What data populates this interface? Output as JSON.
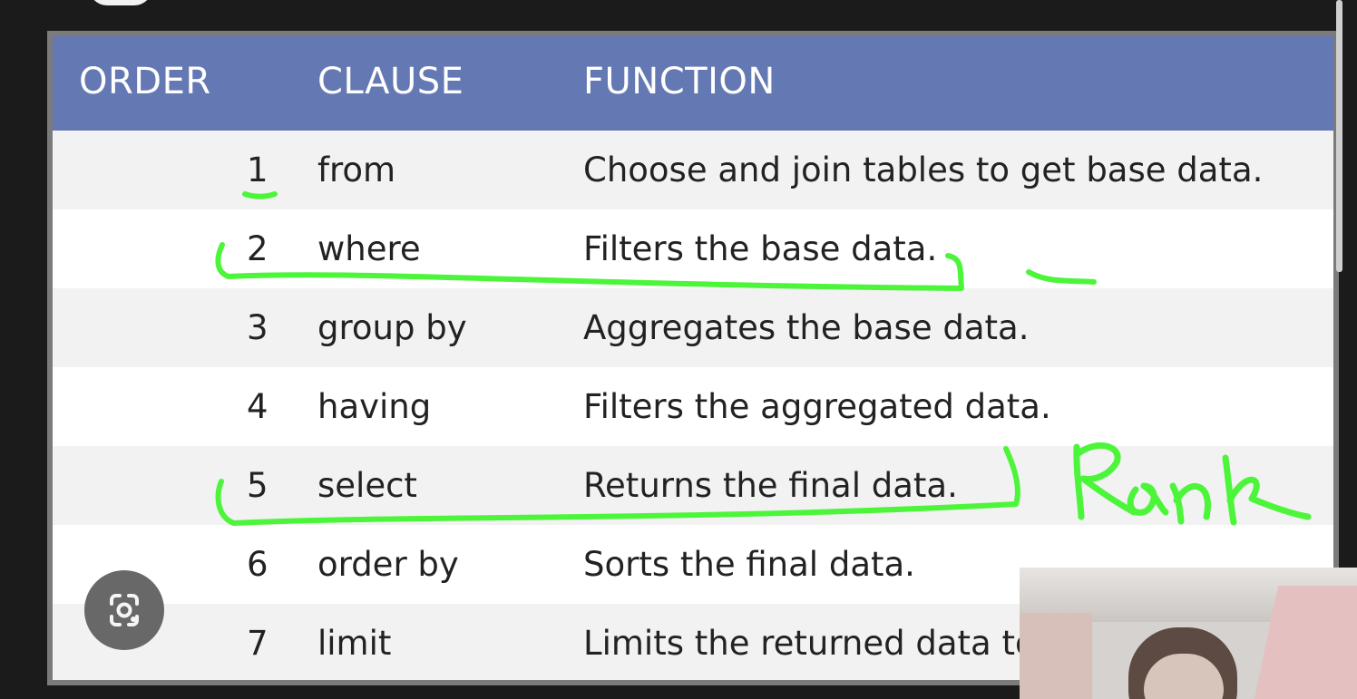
{
  "table": {
    "headers": [
      "ORDER",
      "CLAUSE",
      "FUNCTION"
    ],
    "rows": [
      {
        "order": "1",
        "clause": "from",
        "function": "Choose and join tables to get base data."
      },
      {
        "order": "2",
        "clause": "where",
        "function": "Filters the base data."
      },
      {
        "order": "3",
        "clause": "group by",
        "function": "Aggregates the base data."
      },
      {
        "order": "4",
        "clause": "having",
        "function": "Filters the aggregated data."
      },
      {
        "order": "5",
        "clause": "select",
        "function": "Returns the final data."
      },
      {
        "order": "6",
        "clause": "order by",
        "function": "Sorts the final data."
      },
      {
        "order": "7",
        "clause": "limit",
        "function": "Limits the returned data to"
      }
    ]
  },
  "annotations": {
    "handwritten_text": "Rank",
    "color": "#4CF53A"
  },
  "icons": {
    "lens_button": "lens-icon"
  },
  "colors": {
    "header_bg": "#6478B3",
    "outer_bg": "#1B1B1B",
    "table_bg": "#FFFFFF",
    "alt_row_bg": "#F2F2F2"
  }
}
